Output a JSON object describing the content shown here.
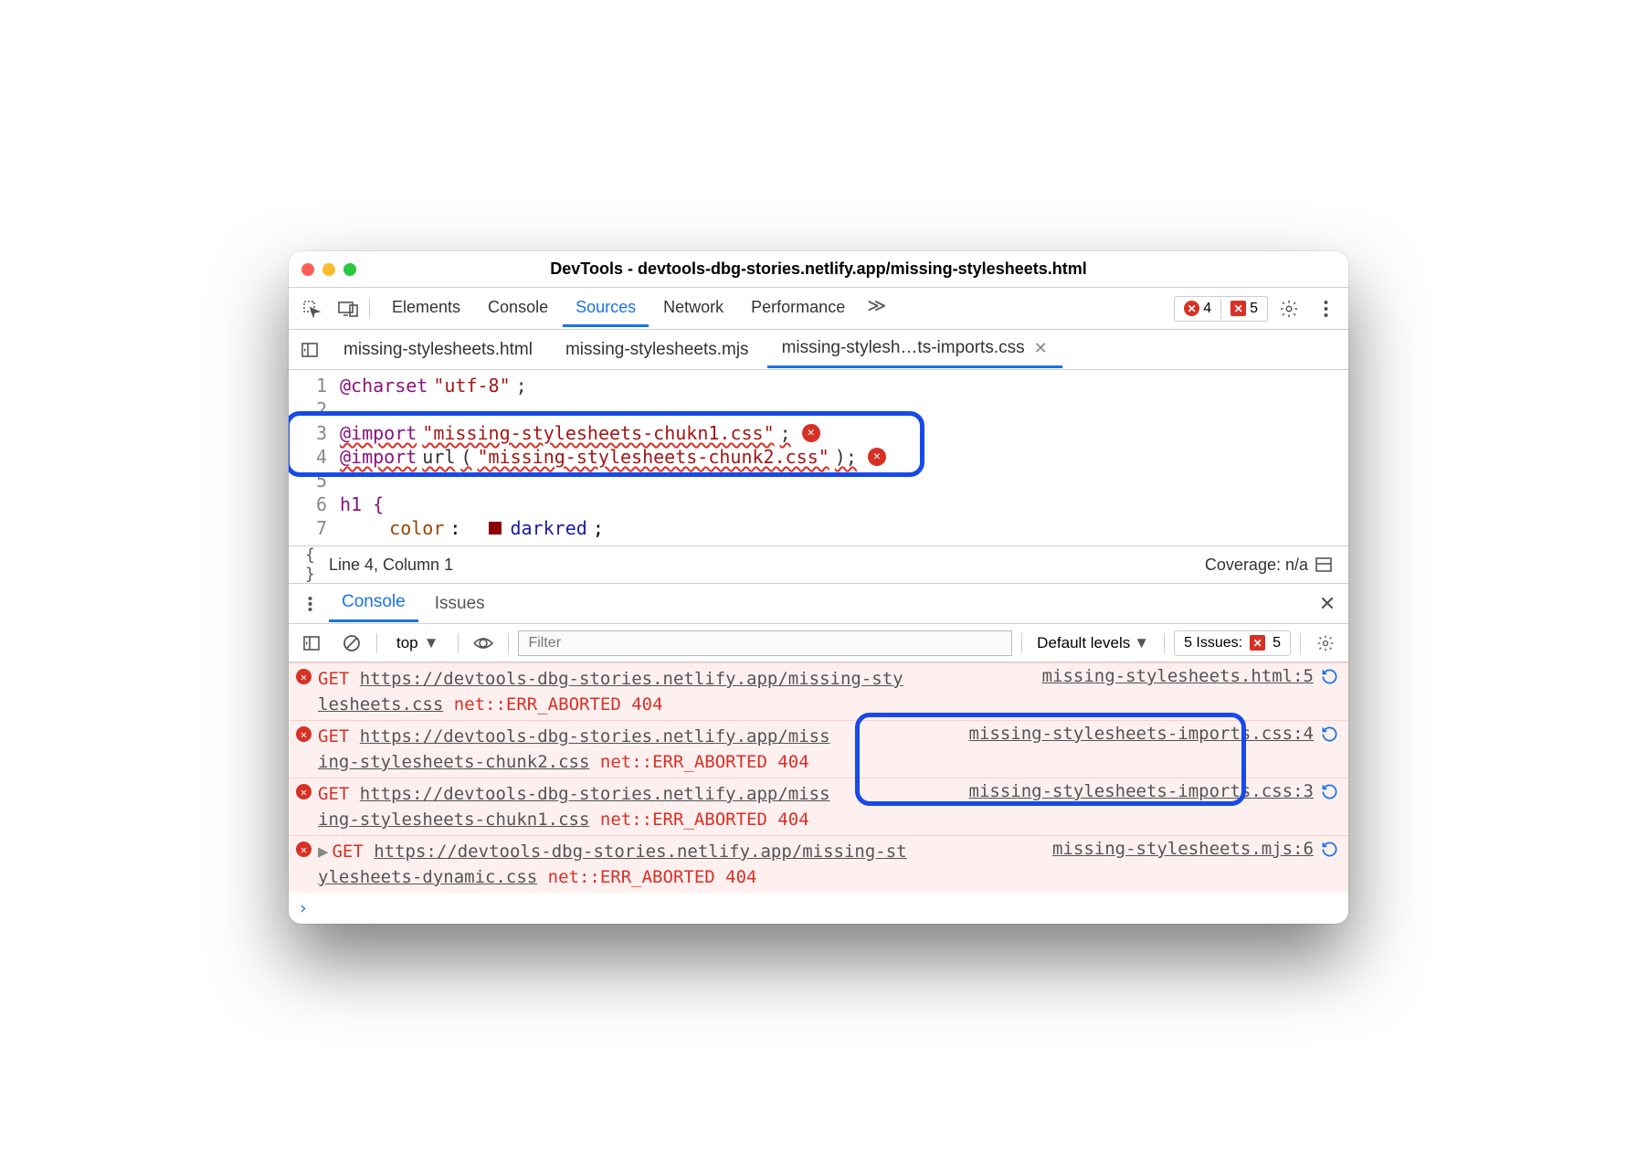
{
  "title": "DevTools - devtools-dbg-stories.netlify.app/missing-stylesheets.html",
  "panels": [
    "Elements",
    "Console",
    "Sources",
    "Network",
    "Performance"
  ],
  "active_panel": "Sources",
  "error_badge": "4",
  "issue_badge": "5",
  "filetabs": [
    {
      "label": "missing-stylesheets.html"
    },
    {
      "label": "missing-stylesheets.mjs"
    },
    {
      "label": "missing-stylesh…ts-imports.css",
      "active": true
    }
  ],
  "code": {
    "l1_a": "@charset",
    "l1_b": "\"utf-8\"",
    "l1_c": ";",
    "l3_a": "@import",
    "l3_b": "\"missing-stylesheets-chukn1.css\"",
    "l3_c": ";",
    "l4_a": "@import",
    "l4_b": "url",
    "l4_c": "(",
    "l4_d": "\"missing-stylesheets-chunk2.css\"",
    "l4_e": ");",
    "l6": "h1 {",
    "l7_a": "    ",
    "l7_b": "color",
    "l7_c": ":  ",
    "l7_d": "darkred",
    "l7_e": ";"
  },
  "status_left": "Line 4, Column 1",
  "status_right": "Coverage: n/a",
  "drawer_tabs": [
    "Console",
    "Issues"
  ],
  "drawer_active": "Console",
  "console_toolbar": {
    "context": "top",
    "filter_ph": "Filter",
    "levels": "Default levels",
    "issues_label": "5 Issues:",
    "issues_count": "5"
  },
  "logs": [
    {
      "method": "GET",
      "url": "https://devtools-dbg-stories.netlify.app/missing-stylesheets.css",
      "url_pre": "https://devtools-dbg-stories.netlify.app/missing-sty",
      "url_wrap": "lesheets.css",
      "err": "net::ERR_ABORTED 404",
      "src": "missing-stylesheets.html:5"
    },
    {
      "method": "GET",
      "url_pre": "https://devtools-dbg-stories.netlify.app/miss",
      "url_wrap": "ing-stylesheets-chunk2.css",
      "err": "net::ERR_ABORTED 404",
      "src": "missing-stylesheets-imports.css:4"
    },
    {
      "method": "GET",
      "url_pre": "https://devtools-dbg-stories.netlify.app/miss",
      "url_wrap": "ing-stylesheets-chukn1.css",
      "err": "net::ERR_ABORTED 404",
      "src": "missing-stylesheets-imports.css:3"
    },
    {
      "method": "GET",
      "url_pre": "https://devtools-dbg-stories.netlify.app/missing-st",
      "url_wrap": "ylesheets-dynamic.css",
      "err": "net::ERR_ABORTED 404",
      "src": "missing-stylesheets.mjs:6",
      "expandable": true
    }
  ]
}
